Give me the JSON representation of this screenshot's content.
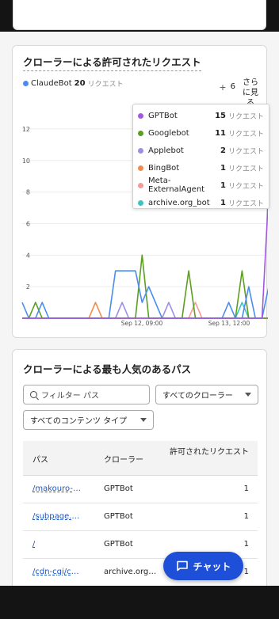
{
  "section_allowed": {
    "title": "クローラーによる許可されたリクエスト",
    "main_legend": {
      "name": "ClaudeBot",
      "value": "20",
      "unit": "リクエスト",
      "color": "#4a8cf0"
    },
    "more": {
      "plus": "+",
      "count": "6",
      "label": "さらに見る"
    }
  },
  "tooltip": [
    {
      "name": "GPTBot",
      "value": "15",
      "unit": "リクエスト",
      "color": "#a259e0"
    },
    {
      "name": "Googlebot",
      "value": "11",
      "unit": "リクエスト",
      "color": "#5c9e1f"
    },
    {
      "name": "Applebot",
      "value": "2",
      "unit": "リクエスト",
      "color": "#9b8ee6"
    },
    {
      "name": "BingBot",
      "value": "1",
      "unit": "リクエスト",
      "color": "#f08c4c"
    },
    {
      "name": "Meta-ExternalAgent",
      "value": "1",
      "unit": "リクエスト",
      "color": "#f59a9a"
    },
    {
      "name": "archive.org_bot",
      "value": "1",
      "unit": "リクエスト",
      "color": "#3cc4c4"
    }
  ],
  "chart_data": {
    "type": "line",
    "x_tick_labels": [
      "Sep 12, 09:00",
      "Sep 13, 12:00"
    ],
    "ylim": [
      0,
      13
    ],
    "y_ticks": [
      2,
      4,
      6,
      8,
      10,
      12
    ],
    "grid": true,
    "series": [
      {
        "name": "ClaudeBot",
        "color": "#4a8cf0",
        "values": [
          1,
          0,
          0,
          1,
          0,
          0,
          0,
          0,
          0,
          0,
          0,
          0,
          0,
          0,
          3,
          3,
          3,
          3,
          1,
          2,
          1,
          0,
          0,
          0,
          0,
          0,
          0,
          0,
          0,
          0,
          0,
          1,
          0,
          0,
          2,
          0,
          0,
          2
        ]
      },
      {
        "name": "Googlebot",
        "color": "#5c9e1f",
        "values": [
          0,
          0,
          1,
          0,
          0,
          0,
          0,
          0,
          0,
          0,
          0,
          0,
          0,
          0,
          0,
          0,
          0,
          0,
          4,
          0,
          0,
          0,
          0,
          0,
          0,
          3,
          0,
          0,
          0,
          0,
          0,
          0,
          0,
          3,
          0,
          0,
          0,
          0
        ]
      },
      {
        "name": "GPTBot",
        "color": "#a259e0",
        "values": [
          0,
          0,
          0,
          0,
          0,
          0,
          0,
          0,
          0,
          0,
          0,
          0,
          0,
          0,
          0,
          0,
          0,
          0,
          0,
          0,
          0,
          0,
          0,
          0,
          0,
          0,
          0,
          0,
          0,
          0,
          0,
          0,
          0,
          0,
          0,
          0,
          0,
          8
        ]
      },
      {
        "name": "Applebot",
        "color": "#9b8ee6",
        "values": [
          0,
          0,
          0,
          0,
          0,
          0,
          0,
          0,
          0,
          0,
          0,
          0,
          0,
          0,
          0,
          1,
          0,
          0,
          0,
          0,
          0,
          0,
          1,
          0,
          0,
          0,
          0,
          0,
          0,
          0,
          0,
          0,
          0,
          0,
          0,
          0,
          0,
          0
        ]
      },
      {
        "name": "BingBot",
        "color": "#f08c4c",
        "values": [
          0,
          0,
          0,
          0,
          0,
          0,
          0,
          0,
          0,
          0,
          0,
          1,
          0,
          0,
          0,
          0,
          0,
          0,
          0,
          0,
          0,
          0,
          0,
          0,
          0,
          0,
          0,
          0,
          0,
          0,
          0,
          0,
          0,
          0,
          0,
          0,
          0,
          0
        ]
      },
      {
        "name": "Meta-ExternalAgent",
        "color": "#f59a9a",
        "values": [
          0,
          0,
          0,
          0,
          0,
          0,
          0,
          0,
          0,
          0,
          0,
          0,
          0,
          0,
          0,
          0,
          0,
          0,
          0,
          0,
          0,
          0,
          0,
          0,
          0,
          0,
          1,
          0,
          0,
          0,
          0,
          0,
          0,
          0,
          0,
          0,
          0,
          0
        ]
      },
      {
        "name": "archive.org_bot",
        "color": "#3cc4c4",
        "values": [
          0,
          0,
          0,
          0,
          0,
          0,
          0,
          0,
          0,
          0,
          0,
          0,
          0,
          0,
          0,
          0,
          0,
          0,
          0,
          0,
          0,
          0,
          0,
          0,
          0,
          0,
          0,
          0,
          0,
          0,
          0,
          0,
          0,
          1,
          0,
          0,
          0,
          0
        ]
      }
    ]
  },
  "section_popular": {
    "title": "クローラーによる最も人気のあるパス",
    "search_placeholder": "フィルター パス",
    "crawler_select": "すべてのクローラー",
    "content_select": "すべてのコンテンツ タイプ",
    "columns": {
      "path": "パス",
      "crawler": "クローラー",
      "requests": "許可されたリクエスト"
    },
    "rows": [
      {
        "path": "/makouro-c...",
        "crawler": "GPTBot",
        "requests": "1"
      },
      {
        "path": "/subpage.css",
        "crawler": "GPTBot",
        "requests": "1"
      },
      {
        "path": "/",
        "crawler": "GPTBot",
        "requests": "1"
      },
      {
        "path": "/cdn-cgi/ch...",
        "crawler": "archive.org_...",
        "requests": "1"
      }
    ]
  },
  "chat_button": {
    "label": "チャット"
  }
}
